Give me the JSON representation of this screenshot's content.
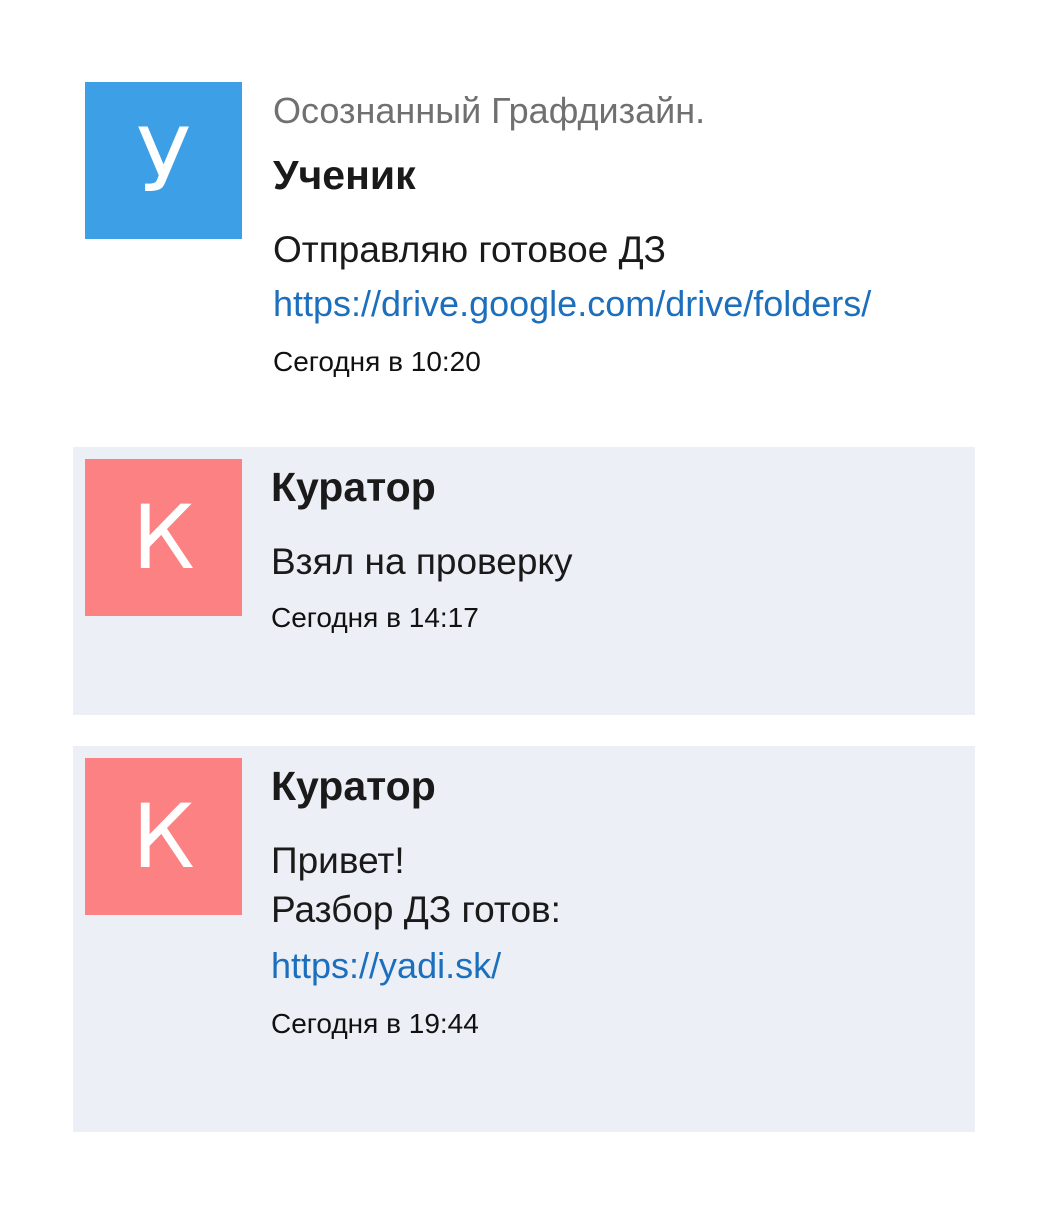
{
  "messages": [
    {
      "avatar_letter": "У",
      "avatar_color": "#3d9fe6",
      "group_name": "Осознанный Графдизайн.",
      "sender": "Ученик",
      "lines": [
        "Отправляю готовое ДЗ"
      ],
      "link": "https://drive.google.com/drive/folders/",
      "time": "Сегодня в 10:20"
    },
    {
      "avatar_letter": "К",
      "avatar_color": "#fb8182",
      "sender": "Куратор",
      "lines": [
        "Взял на проверку"
      ],
      "time": "Сегодня в 14:17"
    },
    {
      "avatar_letter": "К",
      "avatar_color": "#fb8182",
      "sender": "Куратор",
      "lines": [
        "Привет!",
        "Разбор ДЗ готов:"
      ],
      "link": "https://yadi.sk/",
      "time": "Сегодня в 19:44"
    }
  ],
  "colors": {
    "student_avatar": "#3d9fe6",
    "curator_avatar": "#fb8182",
    "curator_bubble": "#eceff6",
    "link": "#1c6fbd"
  }
}
